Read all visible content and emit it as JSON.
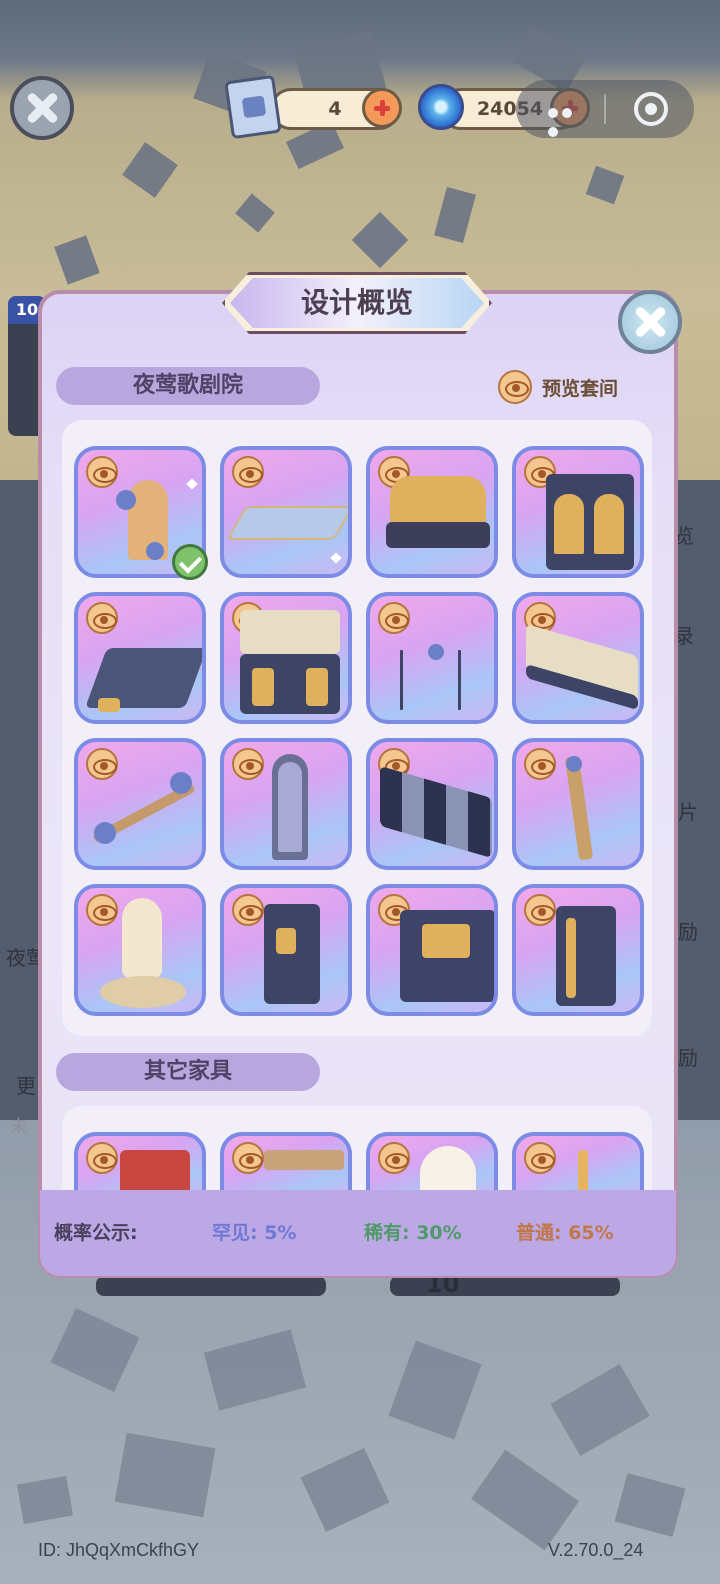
{
  "top_bar": {
    "ticket_count": "4",
    "gem_count": "24054"
  },
  "background_labels": {
    "left_badge_number": "10",
    "right_labels": [
      "览",
      "录",
      "片",
      "励",
      "励"
    ],
    "left_labels": [
      "夜莺",
      "更",
      "未"
    ],
    "bottom_numbers": [
      "10"
    ]
  },
  "modal": {
    "title": "设计概览",
    "section1_title": "夜莺歌剧院",
    "preview_suite_label": "预览套间",
    "section2_title": "其它家具",
    "probability": {
      "label": "概率公示:",
      "rare": "罕见: 5%",
      "epic": "稀有: 30%",
      "common": "普通: 65%"
    },
    "colors": {
      "rare": "#6f78d6",
      "epic": "#4f9a68",
      "common": "#c0784a"
    }
  },
  "footer": {
    "id_text": "ID: JhQqXmCkfhGY",
    "version": "V.2.70.0_24"
  }
}
